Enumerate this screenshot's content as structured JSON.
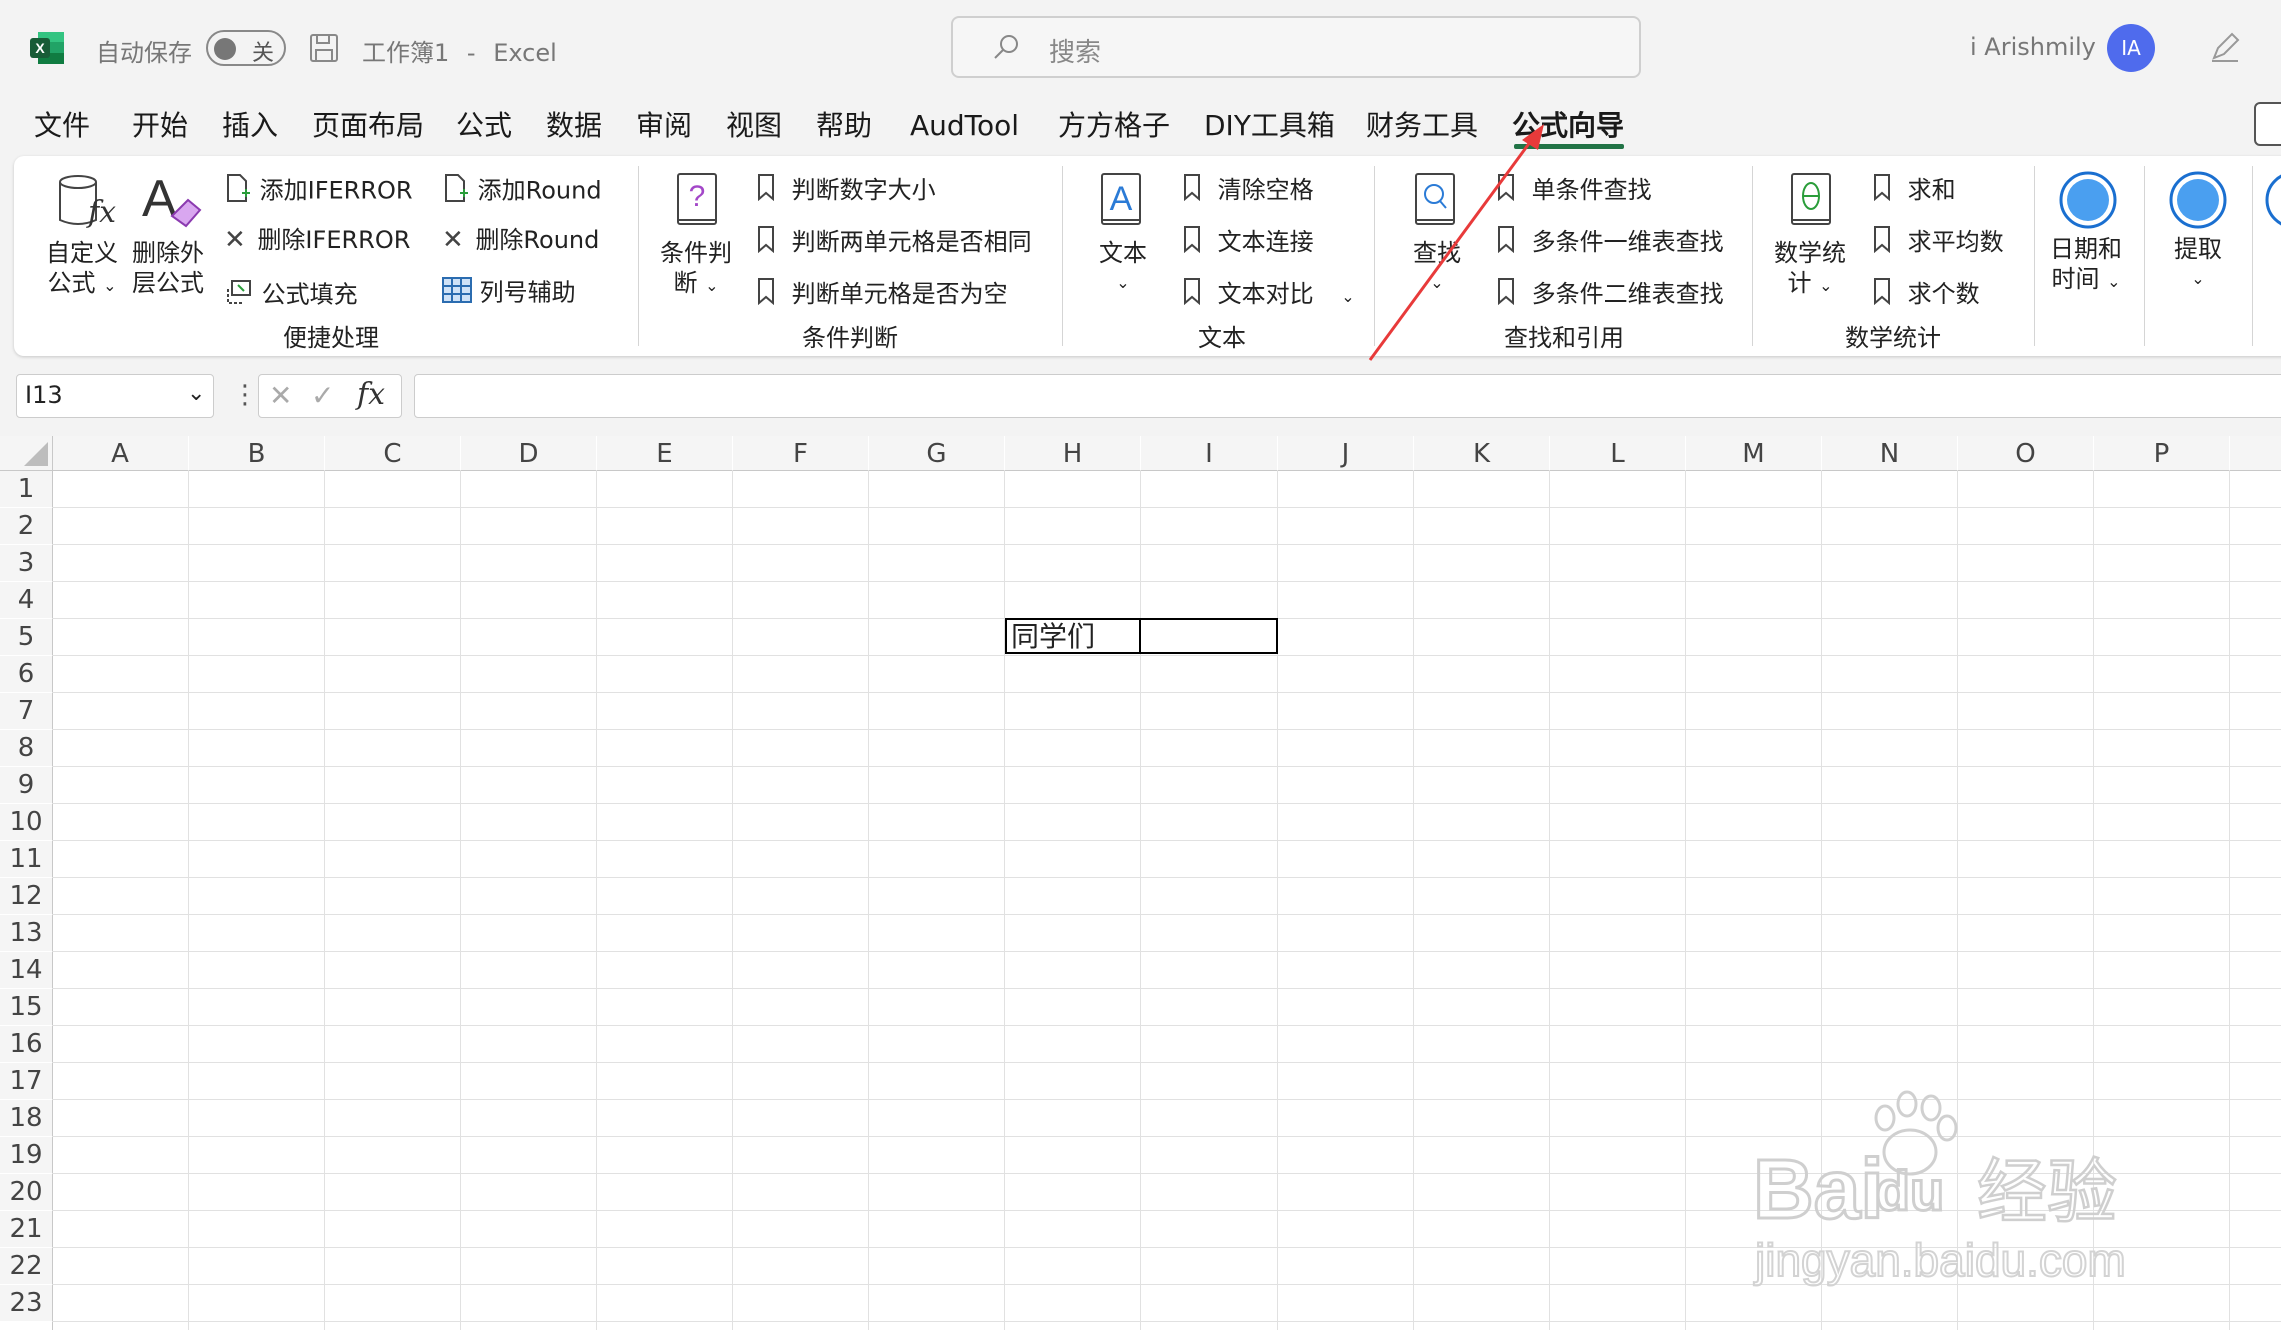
{
  "titlebar": {
    "autosave_label": "自动保存",
    "toggle_state": "关",
    "doc_title": "工作簿1",
    "sep": "-",
    "app_name": "Excel",
    "search_placeholder": "搜索",
    "user_name": "i Arishmily",
    "avatar_initials": "IA"
  },
  "menu": {
    "items": [
      "文件",
      "开始",
      "插入",
      "页面布局",
      "公式",
      "数据",
      "审阅",
      "视图",
      "帮助",
      "AudTool",
      "方方格子",
      "DIY工具箱",
      "财务工具",
      "公式向导"
    ],
    "active": "公式向导",
    "accent_color": "#217346"
  },
  "ribbon": {
    "g1": {
      "title": "便捷处理",
      "custom_formula_l1": "自定义",
      "custom_formula_l2": "公式",
      "delete_outer_l1": "删除外",
      "delete_outer_l2": "层公式",
      "add_iferror": "添加IFERROR",
      "delete_iferror": "删除IFERROR",
      "formula_fill": "公式填充",
      "add_round": "添加Round",
      "delete_round": "删除Round",
      "col_helper": "列号辅助"
    },
    "g2": {
      "title": "条件判断",
      "cond_l1": "条件判",
      "cond_l2": "断",
      "items": [
        "判断数字大小",
        "判断两单元格是否相同",
        "判断单元格是否为空"
      ]
    },
    "g3": {
      "title": "文本",
      "text_btn": "文本",
      "items": [
        "清除空格",
        "文本连接",
        "文本对比"
      ]
    },
    "g4": {
      "title": "查找和引用",
      "find_btn": "查找",
      "items": [
        "单条件查找",
        "多条件一维表查找",
        "多条件二维表查找"
      ]
    },
    "g5": {
      "title": "数学统计",
      "stat_l1": "数学统",
      "stat_l2": "计",
      "items": [
        "求和",
        "求平均数",
        "求个数"
      ]
    },
    "g6": {
      "date_l1": "日期和",
      "date_l2": "时间",
      "extract": "提取"
    }
  },
  "formula_bar": {
    "name_box": "I13",
    "fx": "fx",
    "value": ""
  },
  "sheet": {
    "columns": [
      "A",
      "B",
      "C",
      "D",
      "E",
      "F",
      "G",
      "H",
      "I",
      "J",
      "K",
      "L",
      "M",
      "N",
      "O",
      "P"
    ],
    "rows": [
      "1",
      "2",
      "3",
      "4",
      "5",
      "6",
      "7",
      "8",
      "9",
      "10",
      "11",
      "12",
      "13",
      "14",
      "15",
      "16",
      "17",
      "18",
      "19",
      "20",
      "21",
      "22",
      "23"
    ],
    "cell_h5": "同学们",
    "cell_i5": ""
  },
  "watermark": {
    "brand": "Bai",
    "brand_du": "du",
    "brand_cn": "经验",
    "url": "jingyan.baidu.com"
  },
  "annotation_color": "#e83a3a"
}
